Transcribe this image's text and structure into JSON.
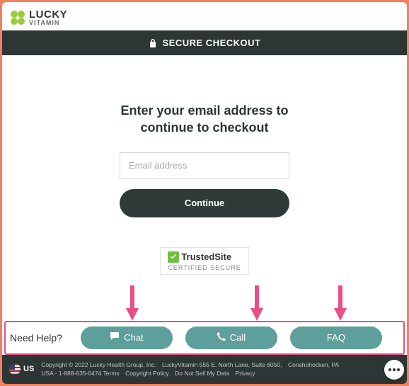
{
  "logo": {
    "brand_top": "LUCKY",
    "brand_sub": "VITAMIN"
  },
  "secure_bar": {
    "label": "SECURE CHECKOUT"
  },
  "main": {
    "heading": "Enter your email address to continue to checkout",
    "email_placeholder": "Email address",
    "email_value": "",
    "continue_label": "Continue"
  },
  "trusted": {
    "name": "TrustedSite",
    "cert": "CERTIFIED SECURE"
  },
  "help": {
    "label": "Need Help?",
    "buttons": [
      {
        "label": "Chat"
      },
      {
        "label": "Call"
      },
      {
        "label": "FAQ"
      }
    ]
  },
  "footer": {
    "country": "US",
    "line": "Copyright © 2022 Lucky Health Group, Inc. LuckyVitamin 555 E. North Lane, Suite 6050, Conshohocken, PA\nUSA - 1-888-635-0474 Terms Copyright Policy Do Not Sell My Data Privacy"
  }
}
